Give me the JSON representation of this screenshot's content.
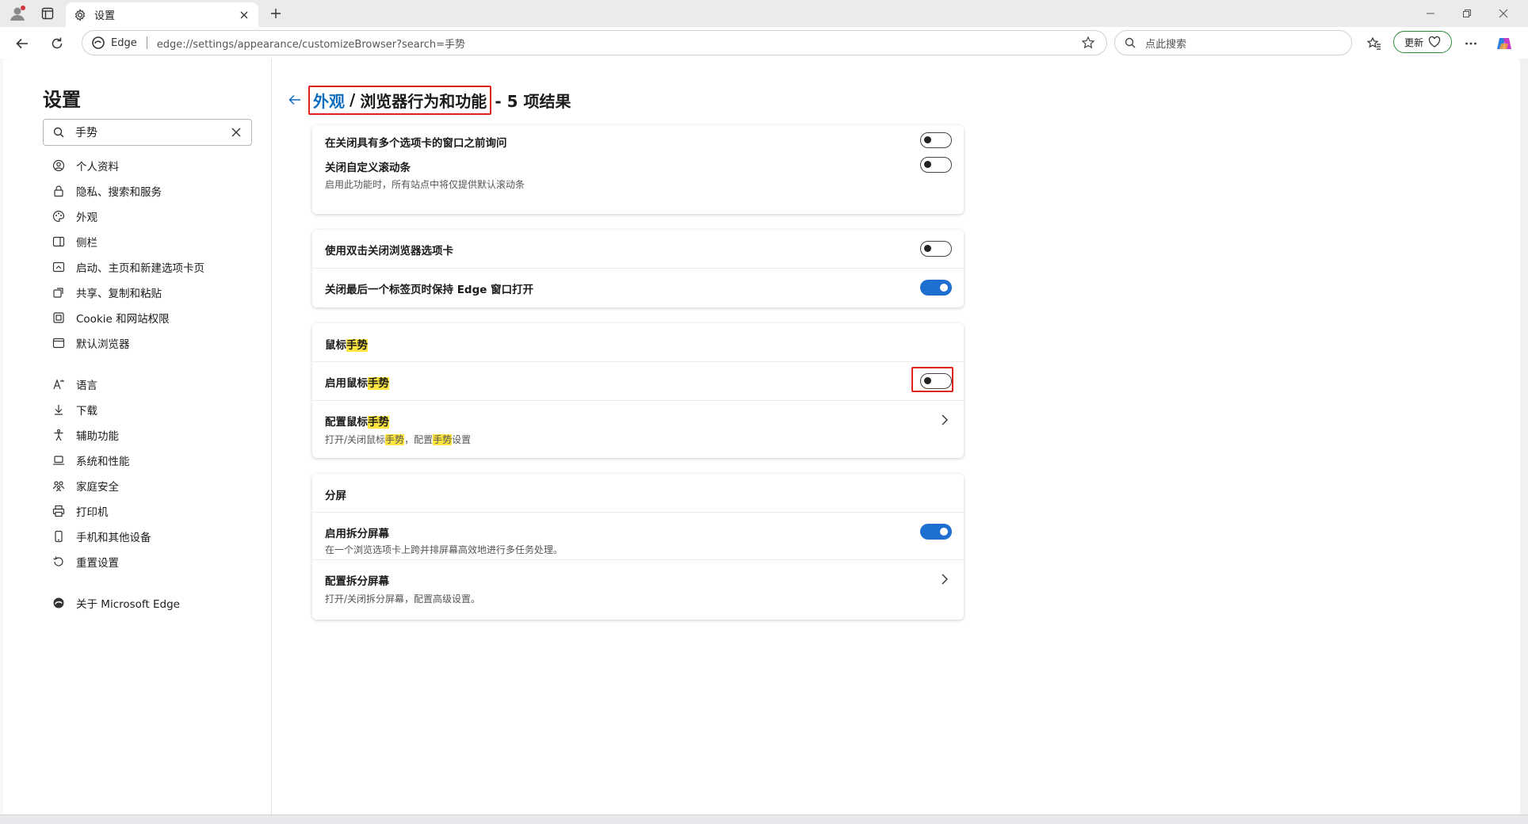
{
  "tab": {
    "title": "设置"
  },
  "address": {
    "brand": "Edge",
    "url": "edge://settings/appearance/customizeBrowser?search=手势"
  },
  "search": {
    "placeholder": "点此搜索"
  },
  "update_label": "更新",
  "sidebar": {
    "title": "设置",
    "search_value": "手势",
    "items": [
      {
        "label": "个人资料",
        "icon": "profile-icon"
      },
      {
        "label": "隐私、搜索和服务",
        "icon": "lock-icon"
      },
      {
        "label": "外观",
        "icon": "palette-icon"
      },
      {
        "label": "侧栏",
        "icon": "sidebar-icon"
      },
      {
        "label": "启动、主页和新建选项卡页",
        "icon": "home-icon"
      },
      {
        "label": "共享、复制和粘贴",
        "icon": "share-icon"
      },
      {
        "label": "Cookie 和网站权限",
        "icon": "cookie-icon"
      },
      {
        "label": "默认浏览器",
        "icon": "browser-icon"
      },
      {
        "label": "语言",
        "icon": "language-icon"
      },
      {
        "label": "下载",
        "icon": "download-icon"
      },
      {
        "label": "辅助功能",
        "icon": "accessibility-icon"
      },
      {
        "label": "系统和性能",
        "icon": "laptop-icon"
      },
      {
        "label": "家庭安全",
        "icon": "family-icon"
      },
      {
        "label": "打印机",
        "icon": "printer-icon"
      },
      {
        "label": "手机和其他设备",
        "icon": "phone-icon"
      },
      {
        "label": "重置设置",
        "icon": "reset-icon"
      },
      {
        "label": "关于 Microsoft Edge",
        "icon": "edge-logo-icon"
      }
    ]
  },
  "header": {
    "crumb_link": "外观",
    "crumb_sep": "/",
    "crumb_current": "浏览器行为和功能",
    "results": "- 5 项结果"
  },
  "cards": {
    "c1": {
      "r1": {
        "label": "在关闭具有多个选项卡的窗口之前询问",
        "toggle": "off"
      },
      "r2": {
        "label": "关闭自定义滚动条",
        "desc": "启用此功能时，所有站点中将仅提供默认滚动条",
        "toggle": "off"
      }
    },
    "c2": {
      "r1": {
        "label": "使用双击关闭浏览器选项卡",
        "toggle": "off"
      },
      "r2": {
        "label": "关闭最后一个标签页时保持 Edge 窗口打开",
        "toggle": "on"
      }
    },
    "c3": {
      "head_pre": "鼠标",
      "head_hl": "手势",
      "r1": {
        "pre": "启用鼠标",
        "hl": "手势",
        "toggle": "off"
      },
      "r2": {
        "pre": "配置鼠标",
        "hl": "手势",
        "desc_a": "打开/关闭鼠标",
        "desc_hl1": "手势",
        "desc_b": "，配置",
        "desc_hl2": "手势",
        "desc_c": "设置"
      }
    },
    "c4": {
      "head": "分屏",
      "r1": {
        "label": "启用拆分屏幕",
        "desc": "在一个浏览选项卡上跨并排屏幕高效地进行多任务处理。",
        "toggle": "on"
      },
      "r2": {
        "label": "配置拆分屏幕",
        "desc": "打开/关闭拆分屏幕，配置高级设置。"
      }
    }
  },
  "colors": {
    "accent": "#1f6fd0",
    "highlight": "#fde540",
    "annotation": "#e0211d",
    "update_border": "#2f8a3c"
  }
}
